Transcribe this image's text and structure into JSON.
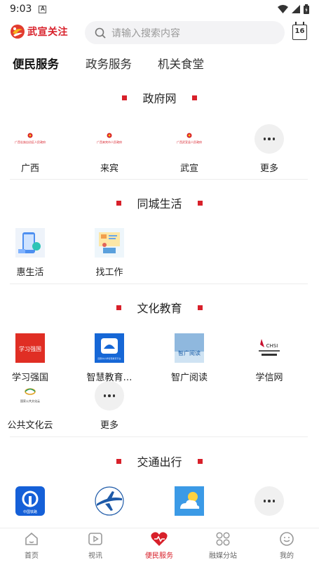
{
  "status_bar": {
    "time": "9:03",
    "notif_glyph": "A"
  },
  "header": {
    "logo_text": "武宣关注",
    "search_placeholder": "请输入搜索内容",
    "calendar_day": "16"
  },
  "tabs": [
    {
      "label": "便民服务",
      "active": true
    },
    {
      "label": "政务服务",
      "active": false
    },
    {
      "label": "机关食堂",
      "active": false
    }
  ],
  "sections": {
    "gov": {
      "title": "政府网",
      "items": [
        {
          "label": "广西",
          "icon": "guangxi-gov-logo",
          "logo_text": "广西壮族自治区人民政府"
        },
        {
          "label": "来宾",
          "icon": "laibin-gov-logo",
          "logo_text": "广西来宾市人民政府"
        },
        {
          "label": "武宣",
          "icon": "wuxuan-gov-logo",
          "logo_text": "广西武宣县人民政府"
        },
        {
          "label": "更多",
          "icon": "more-icon"
        }
      ]
    },
    "city": {
      "title": "同城生活",
      "items": [
        {
          "label": "惠生活",
          "icon": "hui-life-icon"
        },
        {
          "label": "找工作",
          "icon": "find-job-icon"
        }
      ]
    },
    "culture": {
      "title": "文化教育",
      "items": [
        {
          "label": "学习强国",
          "icon": "xuexi-qiangguo-icon",
          "logo_text": "学习强国"
        },
        {
          "label": "智慧教育…",
          "icon": "smart-education-icon",
          "logo_text": "国家中小学智慧教育平台"
        },
        {
          "label": "智广阅读",
          "icon": "zhiguang-reading-icon",
          "logo_text": "智广阅读"
        },
        {
          "label": "学信网",
          "icon": "chsi-icon",
          "logo_text": "CHSI"
        },
        {
          "label": "公共文化云",
          "icon": "public-culture-cloud-icon",
          "logo_text": "国家公共文化云"
        },
        {
          "label": "更多",
          "icon": "more-icon"
        }
      ]
    },
    "transport": {
      "title": "交通出行",
      "items": [
        {
          "label": "",
          "icon": "china-railway-icon",
          "logo_text": "中国铁路"
        },
        {
          "label": "",
          "icon": "airline-icon"
        },
        {
          "label": "",
          "icon": "weather-icon"
        },
        {
          "label": "",
          "icon": "more-icon"
        }
      ]
    }
  },
  "tabbar": [
    {
      "label": "首页",
      "icon": "home-icon",
      "active": false
    },
    {
      "label": "视讯",
      "icon": "video-icon",
      "active": false
    },
    {
      "label": "便民服务",
      "icon": "heart-icon",
      "active": true
    },
    {
      "label": "融媒分站",
      "icon": "grid-icon",
      "active": false
    },
    {
      "label": "我的",
      "icon": "profile-icon",
      "active": false
    }
  ],
  "colors": {
    "brand_red": "#d8202a",
    "gray_text": "#9a9a9a",
    "bg_gray": "#f3f3f5"
  }
}
